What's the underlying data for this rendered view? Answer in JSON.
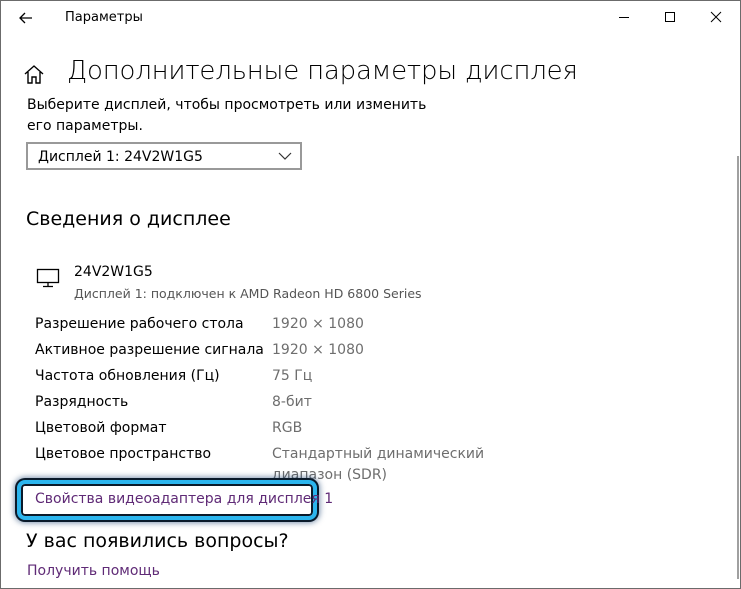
{
  "window": {
    "title": "Параметры"
  },
  "page": {
    "title": "Дополнительные параметры дисплея",
    "prompt": "Выберите дисплей, чтобы просмотреть или изменить его параметры."
  },
  "display_select": {
    "selected": "Дисплей 1: 24V2W1G5"
  },
  "info": {
    "section_title": "Сведения о дисплее",
    "monitor_name": "24V2W1G5",
    "monitor_desc": "Дисплей 1: подключен к AMD Radeon HD 6800 Series",
    "props": [
      {
        "label": "Разрешение рабочего стола",
        "value": "1920 × 1080"
      },
      {
        "label": "Активное разрешение сигнала",
        "value": "1920 × 1080"
      },
      {
        "label": "Частота обновления (Гц)",
        "value": "75 Гц"
      },
      {
        "label": "Разрядность",
        "value": "8-бит"
      },
      {
        "label": "Цветовой формат",
        "value": "RGB"
      },
      {
        "label": "Цветовое пространство",
        "value": "Стандартный динамический диапазон (SDR)"
      }
    ],
    "adapter_link": "Свойства видеоадаптера для дисплея 1"
  },
  "questions": {
    "title": "У вас появились вопросы?",
    "help_link": "Получить помощь"
  },
  "colors": {
    "link": "#5f2a76",
    "highlight": "#2bb5ee"
  }
}
